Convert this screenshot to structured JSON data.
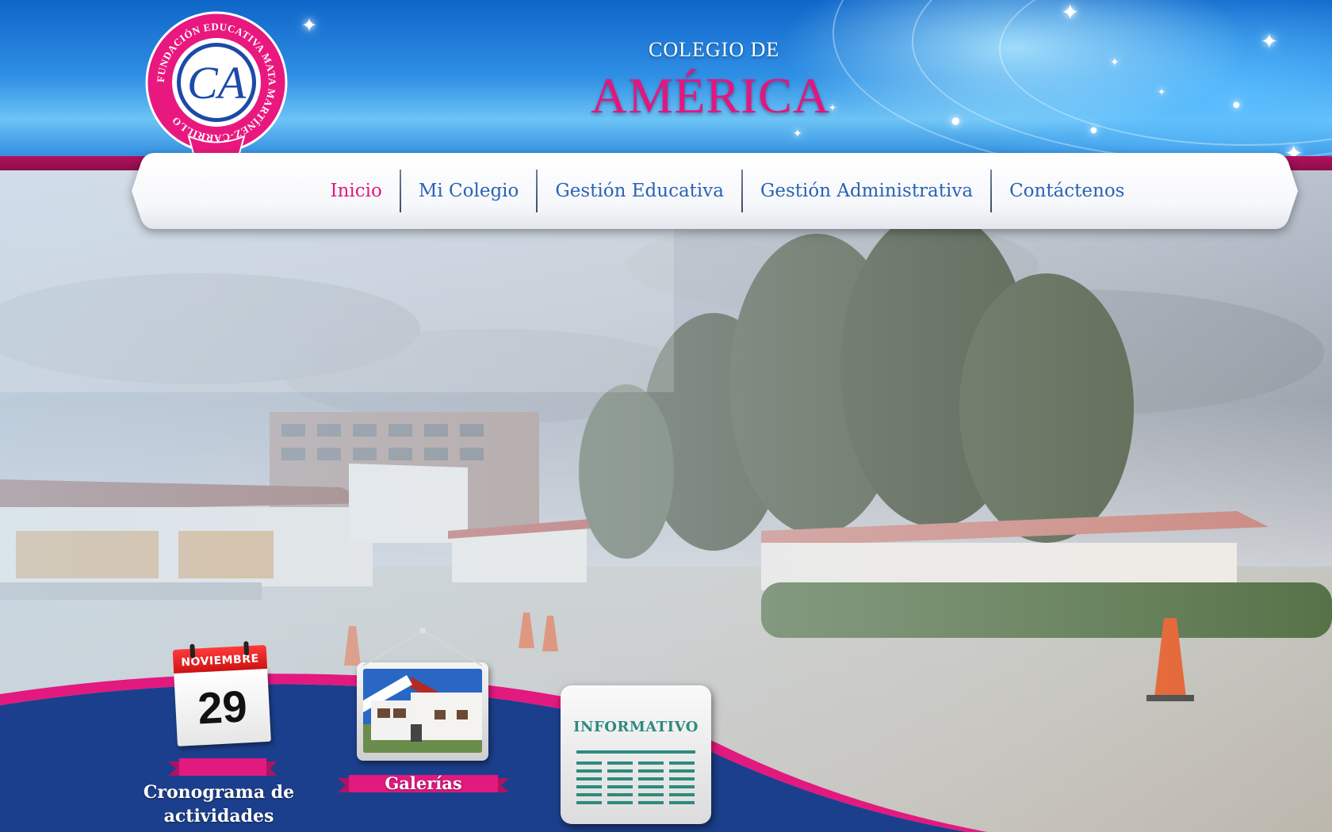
{
  "header": {
    "title_small": "COLEGIO DE",
    "title_large": "AMÉRICA",
    "logo": {
      "ring_text": "FUNDACIÓN EDUCATIVA MATA MARTÍNEZ-CARRILLO",
      "initials": "CA"
    }
  },
  "nav": {
    "items": [
      {
        "label": "Inicio",
        "active": true
      },
      {
        "label": "Mi Colegio",
        "active": false
      },
      {
        "label": "Gestión Educativa",
        "active": false
      },
      {
        "label": "Gestión Administrativa",
        "active": false
      },
      {
        "label": "Contáctenos",
        "active": false
      }
    ]
  },
  "widgets": {
    "calendar": {
      "month": "NOVIEMBRE",
      "day": "29",
      "label": "Cronograma de actividades"
    },
    "gallery": {
      "label": "Galerías"
    },
    "informativo": {
      "label": "INFORMATIVO"
    }
  },
  "colors": {
    "brand_pink": "#e2197f",
    "brand_blue": "#2a62b6",
    "deep_blue": "#1c3f8d"
  }
}
